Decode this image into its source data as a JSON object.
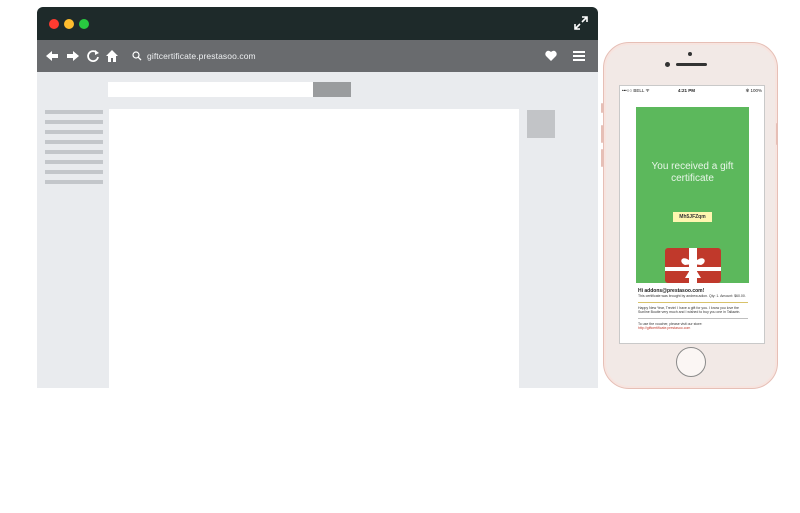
{
  "browser": {
    "url": "giftcertificate.prestasoo.com",
    "colors": {
      "titlebar": "#1e2a2a",
      "navbar": "#696b6e",
      "page_bg": "#e9ebee"
    },
    "icons": [
      "back-arrow-icon",
      "forward-arrow-icon",
      "reload-icon",
      "home-icon",
      "search-icon",
      "heart-icon",
      "hamburger-menu-icon",
      "expand-icon"
    ]
  },
  "phone": {
    "status": {
      "carrier": "•••○○ BELL ᯤ",
      "time": "4:21 PM",
      "battery": "✻ 100%"
    },
    "card": {
      "title": "You received a gift certificate",
      "code": "Mh5JFZqm",
      "accent": "#5cb85c"
    },
    "email": {
      "greeting": "Hi addons@prestasoo.com!",
      "line1": "This certificate was brought by andrew.adion. Qty: 1. Amount: $60.00.",
      "line2": "Happy New Year, Trevin! I have a gift for you. I know you love the Sunline Boutie very much and I wished to buy you one in Tallawin.",
      "line3_prefix": "To use the voucher, please visit our store: ",
      "line3_link": "http://giftcertificate.prestasoo.com"
    }
  }
}
